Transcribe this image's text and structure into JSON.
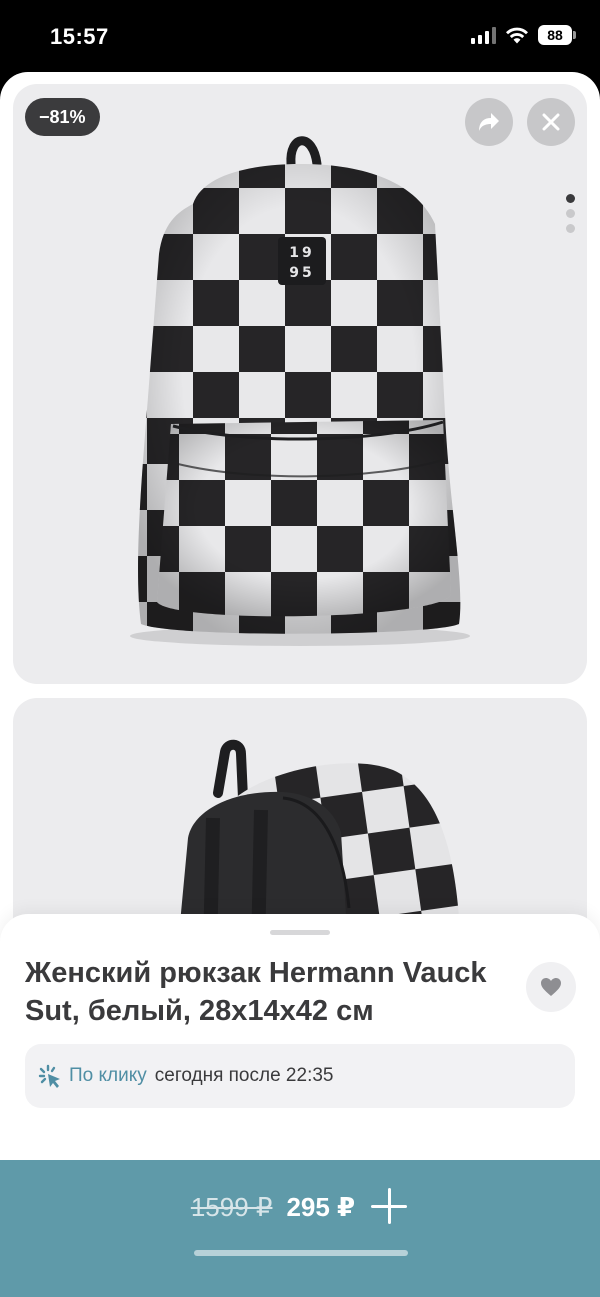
{
  "status_bar": {
    "time": "15:57",
    "battery": "88"
  },
  "gallery": {
    "discount_badge": "−81%",
    "share_icon": "share-arrow-icon",
    "close_icon": "close-x-icon",
    "page_indicator": {
      "count": 3,
      "active": 0
    },
    "patch_text_line1": "19",
    "patch_text_line2": "95"
  },
  "product": {
    "title": "Женский рюкзак Hermann Vauck Sut, белый, 28х14х42 см",
    "favorite_icon": "heart-icon"
  },
  "delivery": {
    "icon": "click-sparkle-icon",
    "label": "По клику",
    "time_text": "сегодня после 22:35"
  },
  "buy_bar": {
    "old_price": "1599 ₽",
    "new_price": "295 ₽",
    "add_icon": "plus-icon"
  },
  "colors": {
    "accent": "#5f9aa9",
    "delivery_link": "#4f8ea4",
    "text_primary": "#3a3a3c"
  }
}
